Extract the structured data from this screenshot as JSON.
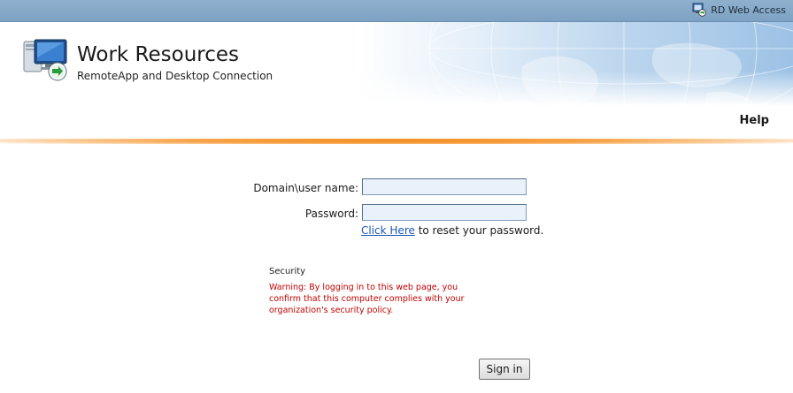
{
  "topbar": {
    "brand_label": "RD Web Access",
    "brand_icon": "remote-desktop-icon"
  },
  "banner": {
    "title": "Work Resources",
    "subtitle": "RemoteApp and Desktop Connection",
    "icon": "remoteapp-monitor-icon"
  },
  "nav": {
    "help_label": "Help"
  },
  "form": {
    "username_label": "Domain\\user name:",
    "username_value": "",
    "password_label": "Password:",
    "password_value": "",
    "reset_link_label": "Click Here",
    "reset_text": " to reset your password.",
    "security_title": "Security",
    "security_warning": "Warning: By logging in to this web page, you confirm that this computer complies with your organization's security policy.",
    "signin_label": "Sign in"
  },
  "colors": {
    "topbar": "#7ea2c3",
    "accent_orange": "#f28a1c",
    "warning_red": "#c00000",
    "link_blue": "#1a54b8",
    "input_background": "#e9f1fb"
  }
}
